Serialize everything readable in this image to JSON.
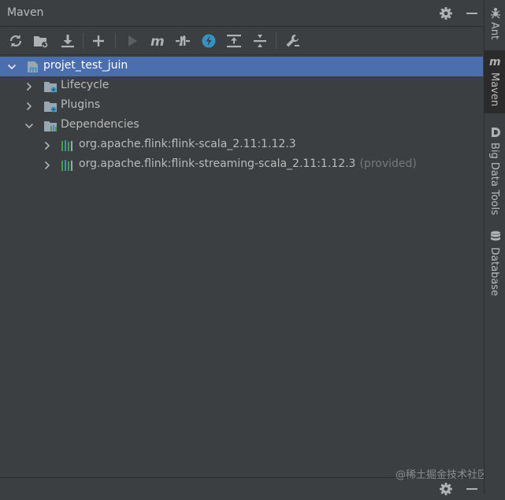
{
  "panel": {
    "title": "Maven"
  },
  "toolbar": {
    "buttons": [
      {
        "name": "reload-icon"
      },
      {
        "name": "generate-sources-icon"
      },
      {
        "name": "download-icon"
      },
      {
        "name": "add-icon"
      },
      {
        "name": "run-icon"
      },
      {
        "name": "execute-goal-icon"
      },
      {
        "name": "toggle-offline-icon"
      },
      {
        "name": "skip-tests-icon"
      },
      {
        "name": "show-dependencies-icon"
      },
      {
        "name": "collapse-all-icon"
      },
      {
        "name": "settings-wrench-icon"
      }
    ]
  },
  "tree": {
    "project": "projet_test_juin",
    "lifecycle": "Lifecycle",
    "plugins": "Plugins",
    "dependencies": "Dependencies",
    "dep1": "org.apache.flink:flink-scala_2.11:1.12.3",
    "dep2": "org.apache.flink:flink-streaming-scala_2.11:1.12.3",
    "dep2_scope": "(provided)"
  },
  "right_tabs": {
    "ant": "Ant",
    "maven": "Maven",
    "bigdata": "Big Data Tools",
    "database": "Database"
  },
  "watermark": "@稀土掘金技术社区",
  "colors": {
    "selection": "#4b6eaf",
    "accent_blue": "#3592c4",
    "green": "#499c54"
  }
}
